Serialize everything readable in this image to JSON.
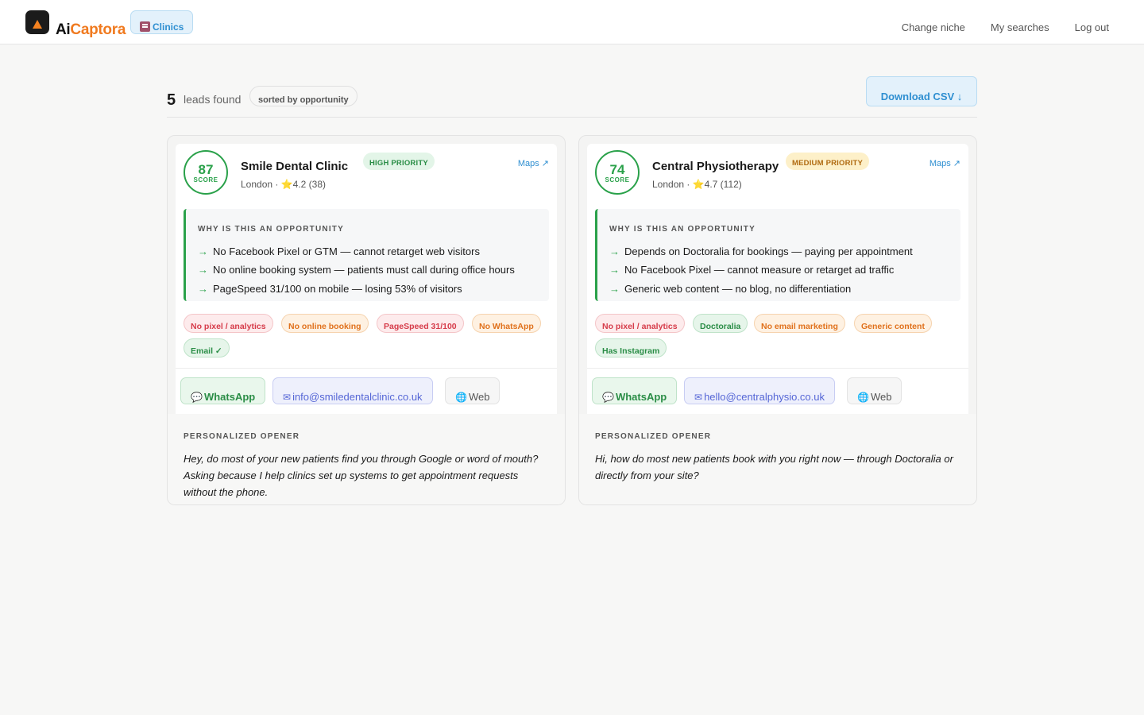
{
  "header": {
    "logo_ai": "Ai",
    "logo_captora": "Captora",
    "niche": "Clinics",
    "nav": [
      "Change niche",
      "My searches",
      "Log out"
    ]
  },
  "summary": {
    "count": "5",
    "count_label": "leads found",
    "sort": "sorted by opportunity",
    "download": "Download CSV ↓"
  },
  "cards": [
    {
      "score": "87",
      "score_label": "SCORE",
      "name": "Smile Dental Clinic",
      "priority": "HIGH PRIORITY",
      "meta": "London · ⭐4.2 (38)",
      "maps": "Maps ↗",
      "why_title": "WHY IS THIS AN OPPORTUNITY",
      "reasons": [
        "No Facebook Pixel or GTM — cannot retarget web visitors",
        "No online booking system — patients must call during office hours",
        "PageSpeed 31/100 on mobile — losing 53% of visitors"
      ],
      "tags": [
        "No pixel / analytics",
        "No online booking",
        "PageSpeed 31/100",
        "No WhatsApp",
        "Email ✓"
      ],
      "contacts": {
        "whatsapp": "WhatsApp",
        "email": "info@smiledentalclinic.co.uk",
        "web": "Web"
      },
      "opener_title": "PERSONALIZED OPENER",
      "opener": "Hey, do most of your new patients find you through Google or word of mouth? Asking because I help clinics set up systems to get appointment requests without the phone."
    },
    {
      "score": "74",
      "score_label": "SCORE",
      "name": "Central Physiotherapy",
      "priority": "MEDIUM PRIORITY",
      "meta": "London · ⭐4.7 (112)",
      "maps": "Maps ↗",
      "why_title": "WHY IS THIS AN OPPORTUNITY",
      "reasons": [
        "Depends on Doctoralia for bookings — paying per appointment",
        "No Facebook Pixel — cannot measure or retarget ad traffic",
        "Generic web content — no blog, no differentiation"
      ],
      "tags": [
        "No pixel / analytics",
        "Doctoralia",
        "No email marketing",
        "Generic content",
        "Has Instagram"
      ],
      "contacts": {
        "whatsapp": "WhatsApp",
        "email": "hello@centralphysio.co.uk",
        "web": "Web"
      },
      "opener_title": "PERSONALIZED OPENER",
      "opener": "Hi, how do most new patients book with you right now — through Doctoralia or directly from your site?"
    }
  ],
  "icons": {
    "logo": "captora-logo-icon",
    "niche": "hospital-icon",
    "whatsapp": "speech-bubble-icon",
    "email": "envelope-icon",
    "web": "globe-icon",
    "rating": "star-icon"
  },
  "colors": {
    "accent_orange": "#f07a1f",
    "score_green": "#2aa14a",
    "link_blue": "#2f8fd1"
  }
}
